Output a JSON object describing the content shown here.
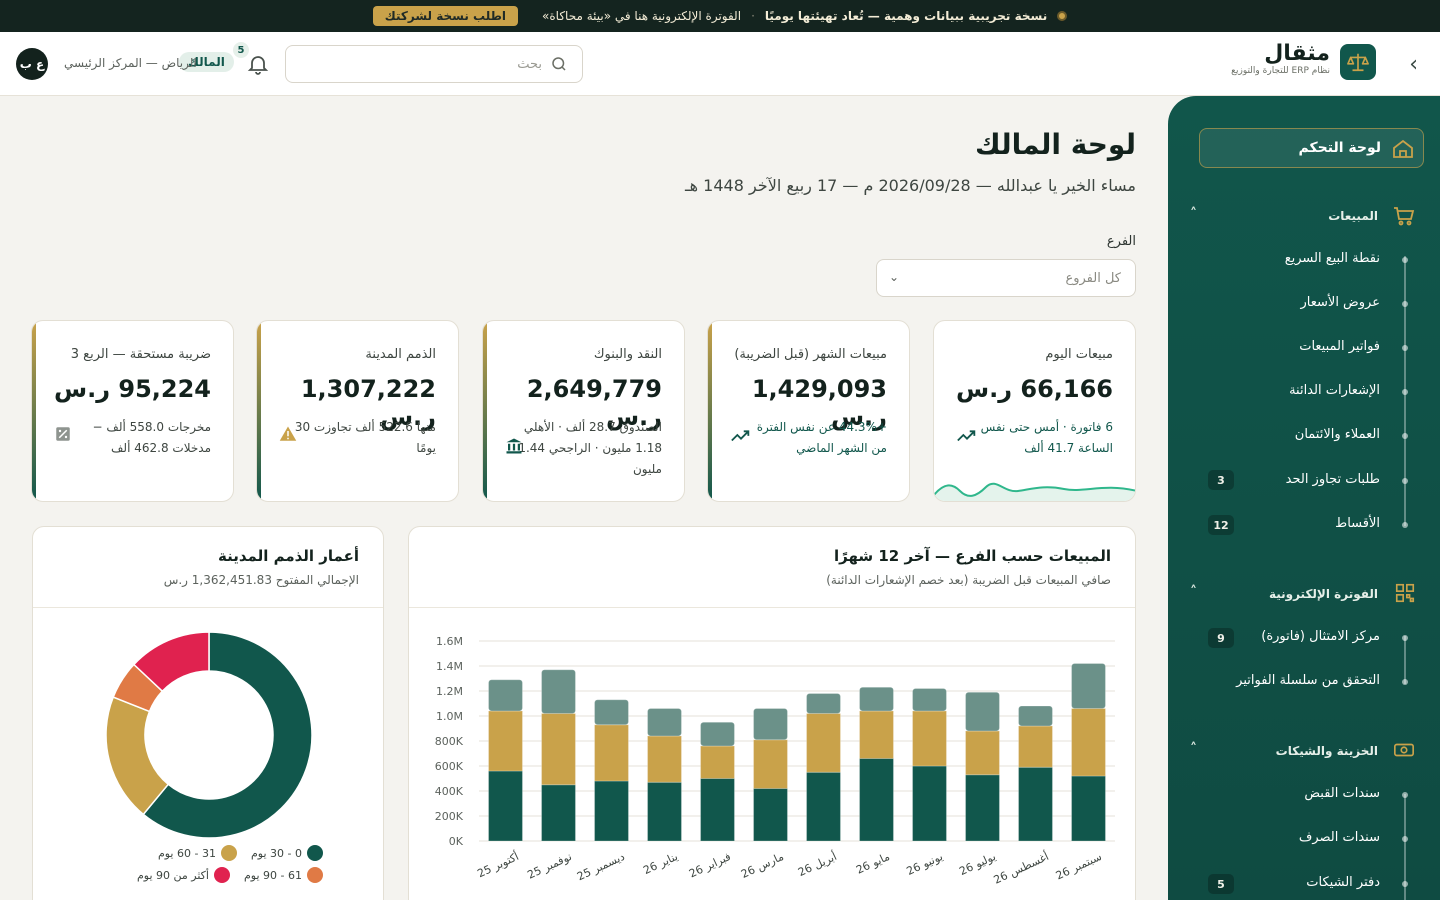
{
  "banner": {
    "demo_text": "نسخة تجريبية ببيانات وهمية — تُعاد تهيئتها يوميًا",
    "sep": "·",
    "einvoice_text": "الفوترة الإلكترونية هنا في «بيئة محاكاة»",
    "cta": "اطلب نسخة لشركتك"
  },
  "header": {
    "brand_name": "مثقال",
    "brand_sub": "نظام ERP للتجارة والتوزيع",
    "search_placeholder": "بحث",
    "notif_count": "5",
    "role": "المالك",
    "branch": "الرياض — المركز الرئيسي",
    "avatar_initials": "ع ب"
  },
  "sidebar": {
    "dashboard": "لوحة التحكم",
    "sections": [
      {
        "label": "المبيعات",
        "icon": "cart-icon",
        "items": [
          {
            "label": "نقطة البيع السريع",
            "count": ""
          },
          {
            "label": "عروض الأسعار",
            "count": ""
          },
          {
            "label": "فواتير المبيعات",
            "count": ""
          },
          {
            "label": "الإشعارات الدائنة",
            "count": ""
          },
          {
            "label": "العملاء والائتمان",
            "count": ""
          },
          {
            "label": "طلبات تجاوز الحد",
            "count": "3"
          },
          {
            "label": "الأقساط",
            "count": "12"
          }
        ]
      },
      {
        "label": "الفوترة الإلكترونية",
        "icon": "qr-icon",
        "items": [
          {
            "label": "مركز الامتثال (فاتورة)",
            "count": "9"
          },
          {
            "label": "التحقق من سلسلة الفواتير",
            "count": ""
          }
        ]
      },
      {
        "label": "الخزينة والشيكات",
        "icon": "cash-icon",
        "items": [
          {
            "label": "سندات القبض",
            "count": ""
          },
          {
            "label": "سندات الصرف",
            "count": ""
          },
          {
            "label": "دفتر الشيكات",
            "count": "5"
          }
        ]
      }
    ]
  },
  "main": {
    "title": "لوحة المالك",
    "greeting": "مساء الخير يا عبدالله — 2026/09/28 م — 17 ربيع الآخر 1448 هـ",
    "branch_label": "الفرع",
    "branch_value": "كل الفروع"
  },
  "kpis": [
    {
      "title": "مبيعات اليوم",
      "value": "66,166 ر.س",
      "detail": "6 فاتورة · أمس حتى نفس الساعة 41.7 ألف",
      "icon": "trend-up-icon"
    },
    {
      "title": "مبيعات الشهر (قبل الضريبة)",
      "value": "1,429,093 ر.س",
      "detail": "+44.3% عن نفس الفترة من الشهر الماضي",
      "icon": "trend-up-icon"
    },
    {
      "title": "النقد والبنوك",
      "value": "2,649,779 ر.س",
      "detail": "الصندوق 28.7 ألف · الأهلي 1.18 مليون · الراجحي 1.44 مليون",
      "icon": "bank-icon"
    },
    {
      "title": "الذمم المدينة",
      "value": "1,307,222 ر.س",
      "detail": "منها 522.6 ألف تجاوزت 30 يومًا",
      "icon": "warning-icon"
    },
    {
      "title": "ضريبة مستحقة — الربع 3",
      "value": "95,224 ر.س",
      "detail": "مخرجات 558.0 ألف − مدخلات 462.8 ألف",
      "icon": "percent-icon"
    }
  ],
  "sales_chart": {
    "title": "المبيعات حسب الفرع — آخر 12 شهرًا",
    "subtitle": "صافي المبيعات قبل الضريبة (بعد خصم الإشعارات الدائنة)"
  },
  "aging": {
    "title": "أعمار الذمم المدينة",
    "subtitle": "الإجمالي المفتوح 1,362,451.83 ر.س",
    "legend": [
      {
        "label": "0 - 30 يوم",
        "color": "#11574c"
      },
      {
        "label": "31 - 60 يوم",
        "color": "#c9a24a"
      },
      {
        "label": "61 - 90 يوم",
        "color": "#e07a45"
      },
      {
        "label": "أكثر من 90 يوم",
        "color": "#e0224f"
      }
    ]
  },
  "chart_data": [
    {
      "type": "bar",
      "stacked": true,
      "categories": [
        "أكتوبر 25",
        "نوفمبر 25",
        "ديسمبر 25",
        "يناير 26",
        "فبراير 26",
        "مارس 26",
        "أبريل 26",
        "مايو 26",
        "يونيو 26",
        "يوليو 26",
        "أغسطس 26",
        "سبتمبر 26"
      ],
      "series": [
        {
          "values": [
            560000,
            450000,
            480000,
            470000,
            500000,
            420000,
            550000,
            660000,
            600000,
            530000,
            590000,
            520000
          ],
          "color": "#11574c"
        },
        {
          "values": [
            480000,
            570000,
            450000,
            370000,
            260000,
            390000,
            470000,
            380000,
            440000,
            350000,
            330000,
            540000
          ],
          "color": "#c9a24a"
        },
        {
          "values": [
            250000,
            350000,
            200000,
            220000,
            190000,
            250000,
            160000,
            190000,
            180000,
            310000,
            160000,
            360000
          ],
          "color": "#6b9189"
        }
      ],
      "y_ticks": [
        "0K",
        "200K",
        "400K",
        "600K",
        "800K",
        "1.0M",
        "1.2M",
        "1.4M",
        "1.6M"
      ],
      "ylim": [
        0,
        1600000
      ],
      "grid": true
    },
    {
      "type": "pie",
      "donut": true,
      "labels": [
        "0 - 30 يوم",
        "31 - 60 يوم",
        "61 - 90 يوم",
        "أكثر من 90 يوم"
      ],
      "values": [
        61,
        20,
        6,
        13
      ],
      "colors": [
        "#11574c",
        "#c9a24a",
        "#e07a45",
        "#e0224f"
      ]
    }
  ]
}
